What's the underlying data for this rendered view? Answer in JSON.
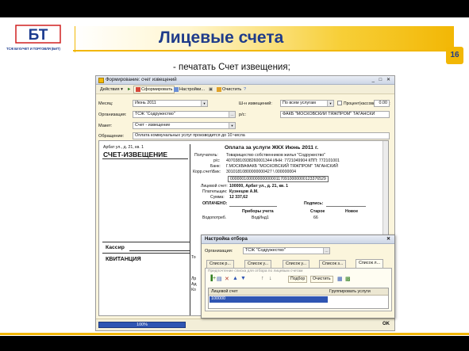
{
  "slide": {
    "logo_text": "БТ",
    "logo_caption": "ТСЖ БУХУЧЕТ И ТОРГОВЛЯ (БИТ)",
    "title": "Лицевые счета",
    "page_number": "16",
    "subtitle": "- печатать Счет извещения;"
  },
  "window": {
    "title": "Формирование: счет извещений",
    "toolbar": {
      "actions": "Действия",
      "generate": "Сформировать",
      "settings": "Настройки...",
      "clear": "Очистить"
    },
    "fields": {
      "month_label": "Месяц:",
      "month_value": "Июнь 2011",
      "barcode_label": "Ш-н извещений:",
      "barcode_value": "По всем услугам",
      "percent_label": "Процент(кассовый сбор):",
      "percent_value": "0.00",
      "org_label": "Организация:",
      "org_value": "ТСЖ \"Содружество\"",
      "account_label": "р/с:",
      "account_value": "ФАКБ \"МОСКОВСКИЙ ТЯЖПРОМ\" ТАГАНСКИ",
      "layout_label": "Макет:",
      "layout_value": "Счет - извещение",
      "notice_label": "Обращение:",
      "notice_value": "Оплата коммунальных услуг производится до 10 числа"
    },
    "document": {
      "address": "Арбат ул., д. 21, кв. 1",
      "form_title": "СЧЕТ-ИЗВЕЩЕНИЕ",
      "heading": "Оплата за услуги ЖКХ Июнь 2011 г.",
      "recipient_label": "Получатель:",
      "recipient_value": "Товарищество собственников жилья \"Содружество\"",
      "rs_label": "р/с:",
      "rs_value": "40703810938260001344  ИНН: 7721049904  КПП: 772101001",
      "bank_label": "Банк:",
      "bank_value": "Г.МОСКВАФАКБ \"МОСКОВСКИЙ ТЯЖПРОМ\" ТАГАНСКИЙ",
      "corr_label": "Корр.счет\\Бик:",
      "corr_value": "30101810800000000427 \\ 000000004",
      "code_line": "000000100000000000001170910000000123376529",
      "ls_label": "Лицевой счет:",
      "ls_value": "100000,  Арбат ул., д. 21, кв. 1",
      "payer_label": "Плательщик:",
      "payer_value": "Кузнецов А.М.",
      "sum_label": "Сумма:",
      "sum_value": "12 337,62",
      "paid_label": "ОПЛАЧЕНО:",
      "sign_label": "Подпись:",
      "meters_label": "Приборы учета",
      "old_label": "Старое",
      "new_label": "Новое",
      "water_label": "Водопотреб.",
      "water_meter": "ВодИнд1",
      "water_old": "66",
      "cashier_label": "Кассир",
      "receipt_label": "КВИТАНЦИЯ",
      "frag_to": "То",
      "frag_lines": [
        "Лр",
        "Ад",
        "Ко"
      ]
    },
    "status": {
      "progress_text": "100%",
      "progress_value": 1.0,
      "ok": "OK"
    }
  },
  "dialog": {
    "title": "Настройка отбора",
    "org_label": "Организация:",
    "org_value": "ТСЖ \"Содружество\"",
    "tabs": [
      "Список р...",
      "Список у...",
      "Список у...",
      "Список з...",
      "Список л..."
    ],
    "hint": "Предпочтение списка для отбора по лицевым счетам",
    "toolbar": {
      "selection": "Подбор",
      "clear": "Очистить"
    },
    "grid_headers": [
      "Лицевой счет",
      "Группировать услуги"
    ],
    "grid_rows": [
      "100000"
    ]
  }
}
